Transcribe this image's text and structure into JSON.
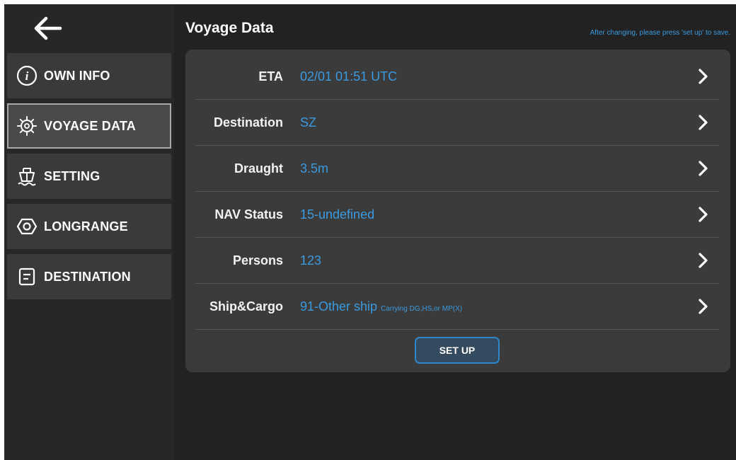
{
  "header": {
    "title": "Voyage Data",
    "hint": "After changing, please press 'set up' to save."
  },
  "sidebar": {
    "items": [
      {
        "label": "OWN INFO",
        "icon": "info-icon",
        "active": false
      },
      {
        "label": "VOYAGE DATA",
        "icon": "ship-wheel-icon",
        "active": true
      },
      {
        "label": "SETTING",
        "icon": "ship-icon",
        "active": false
      },
      {
        "label": "LONGRANGE",
        "icon": "hexagon-icon",
        "active": false
      },
      {
        "label": "DESTINATION",
        "icon": "document-icon",
        "active": false
      }
    ]
  },
  "fields": [
    {
      "label": "ETA",
      "value": "02/01 01:51 UTC",
      "sub": ""
    },
    {
      "label": "Destination",
      "value": "SZ",
      "sub": ""
    },
    {
      "label": "Draught",
      "value": "3.5m",
      "sub": ""
    },
    {
      "label": "NAV Status",
      "value": "15-undefined",
      "sub": ""
    },
    {
      "label": "Persons",
      "value": "123",
      "sub": ""
    },
    {
      "label": "Ship&Cargo",
      "value": "91-Other ship",
      "sub": "Carrying DG,HS,or MP(X)"
    }
  ],
  "actions": {
    "setup_label": "SET UP"
  },
  "colors": {
    "accent": "#3b9ae0",
    "background": "#222222",
    "sidebar": "#272727",
    "panel": "#3b3b3b"
  }
}
